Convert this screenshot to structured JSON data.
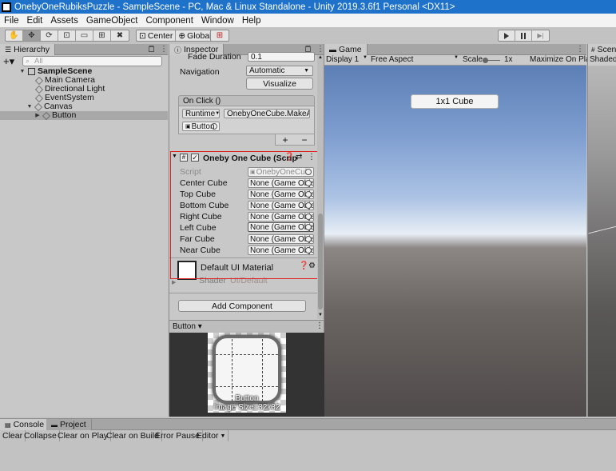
{
  "window": {
    "title": "OnebyOneRubiksPuzzle - SampleScene - PC, Mac & Linux Standalone - Unity 2019.3.6f1 Personal <DX11>"
  },
  "menu": [
    "File",
    "Edit",
    "Assets",
    "GameObject",
    "Component",
    "Window",
    "Help"
  ],
  "toolbar": {
    "pivot_label": "Center",
    "space_label": "Global"
  },
  "hierarchy": {
    "tab_label": "Hierarchy",
    "search_placeholder": "All",
    "items": [
      {
        "label": "SampleScene",
        "icon": "unity-scene-icon"
      },
      {
        "label": "Main Camera",
        "icon": "cube-icon"
      },
      {
        "label": "Directional Light",
        "icon": "cube-icon"
      },
      {
        "label": "EventSystem",
        "icon": "cube-icon"
      },
      {
        "label": "Canvas",
        "icon": "cube-icon"
      },
      {
        "label": "Button",
        "icon": "cube-icon"
      }
    ]
  },
  "inspector": {
    "tab_label": "Inspector",
    "fade_duration_label": "Fade Duration",
    "fade_duration_value": "0.1",
    "navigation_label": "Navigation",
    "navigation_value": "Automatic",
    "visualize_label": "Visualize",
    "onclick_label": "On Click ()",
    "runtime_value": "Runtime",
    "method_value": "OnebyOneCube.MakeA",
    "target_value": "Button",
    "plus_label": "+",
    "minus_label": "−",
    "component": {
      "title": "Oneby One Cube (Scrip",
      "script_label": "Script",
      "script_value": "OnebyOneCub",
      "fields": [
        {
          "label": "Center Cube",
          "value": "None (Game Obje"
        },
        {
          "label": "Top Cube",
          "value": "None (Game Obje"
        },
        {
          "label": "Bottom Cube",
          "value": "None (Game Obje"
        },
        {
          "label": "Right Cube",
          "value": "None (Game Obje"
        },
        {
          "label": "Left Cube",
          "value": "None (Game Obje"
        },
        {
          "label": "Far Cube",
          "value": "None (Game Obje"
        },
        {
          "label": "Near Cube",
          "value": "None (Game Obje"
        }
      ]
    },
    "material_label": "Default UI Material",
    "shader_label": "Shader",
    "shader_value": "UI/Default",
    "add_component_label": "Add Component",
    "preview_dropdown": "Button",
    "preview_caption": "Button",
    "preview_size": "Image Size: 32x32"
  },
  "game": {
    "tab_label": "Game",
    "display_value": "Display 1",
    "aspect_value": "Free Aspect",
    "scale_label": "Scale",
    "scale_value": "1x",
    "maximize_label": "Maximize On Play",
    "button_label": "1x1 Cube"
  },
  "scene": {
    "tab_label": "Scen",
    "shading_value": "Shaded"
  },
  "console": {
    "tab_label": "Console",
    "project_tab_label": "Project",
    "buttons": [
      "Clear",
      "Collapse",
      "Clear on Play",
      "Clear on Build",
      "Error Pause",
      "Editor"
    ]
  },
  "colors": {
    "title_bar": "#1e72c9",
    "highlight_box": "#e0201c",
    "panel_bg": "#c8c8c8"
  }
}
